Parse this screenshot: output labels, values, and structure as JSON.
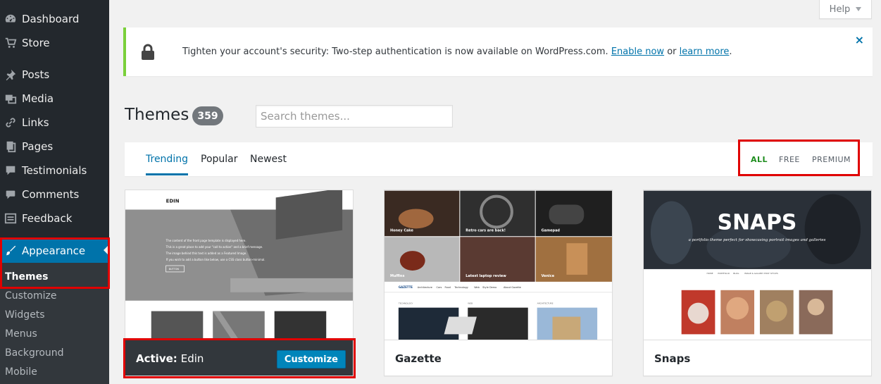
{
  "sidebar": {
    "items": [
      {
        "label": "Dashboard",
        "icon": "dashboard-icon"
      },
      {
        "label": "Store",
        "icon": "cart-icon"
      },
      {
        "label": "Posts",
        "icon": "pin-icon"
      },
      {
        "label": "Media",
        "icon": "media-icon"
      },
      {
        "label": "Links",
        "icon": "link-icon"
      },
      {
        "label": "Pages",
        "icon": "pages-icon"
      },
      {
        "label": "Testimonials",
        "icon": "testimonial-icon"
      },
      {
        "label": "Comments",
        "icon": "comment-icon"
      },
      {
        "label": "Feedback",
        "icon": "feedback-icon"
      },
      {
        "label": "Appearance",
        "icon": "paintbrush-icon"
      }
    ],
    "submenu": [
      "Themes",
      "Customize",
      "Widgets",
      "Menus",
      "Background",
      "Mobile"
    ]
  },
  "help": {
    "label": "Help"
  },
  "notice": {
    "text": "Tighten your account's security: Two-step authentication is now available on WordPress.com.",
    "link1": "Enable now",
    "sep": "or",
    "link2": "learn more",
    "end": ".",
    "dismiss": "×"
  },
  "header": {
    "title": "Themes",
    "count": "359",
    "search_placeholder": "Search themes..."
  },
  "filters": {
    "tabs": [
      "Trending",
      "Popular",
      "Newest"
    ],
    "price": [
      "ALL",
      "FREE",
      "PREMIUM"
    ]
  },
  "themes": {
    "active_label": "Active:",
    "active_name": "Edin",
    "customize": "Customize",
    "edin": {
      "logo": "EDIN",
      "menu": "MENU",
      "hero_lines": [
        "The content of the front page template is displayed here.",
        "This is a great place to add your \"call to action\" and a brief message.",
        "The image behind this text is added as a Featured Image.",
        "If you wish to add a button like below, use a CSS class button-minimal."
      ],
      "button": "BUTTON"
    },
    "gazette": {
      "name": "Gazette",
      "tiles": [
        "Honey Cake",
        "Retro cars are back!",
        "Gamepad",
        "Muffins",
        "Latest laptop review",
        "Venice"
      ],
      "logo": "GAZETTE",
      "nav": [
        "Architecture",
        "Cars",
        "Food",
        "Technology",
        "Web",
        "Style Demo",
        "About Gazette"
      ],
      "sections": [
        "TECHNOLOGY",
        "WEB",
        "ARCHITECTURE"
      ]
    },
    "snaps": {
      "name": "Snaps",
      "title": "SNAPS",
      "tagline": "a portfolio theme perfect for showcasing portrait images and galleries",
      "nav": [
        "HOME",
        "PORTFOLIO",
        "BLOG",
        "IMAGE & GALLERY POST STYLES"
      ]
    }
  },
  "colors": {
    "sidebar": "#23282d",
    "accent": "#0073aa",
    "highlight": "#e00000",
    "notice": "#7ad03a"
  }
}
